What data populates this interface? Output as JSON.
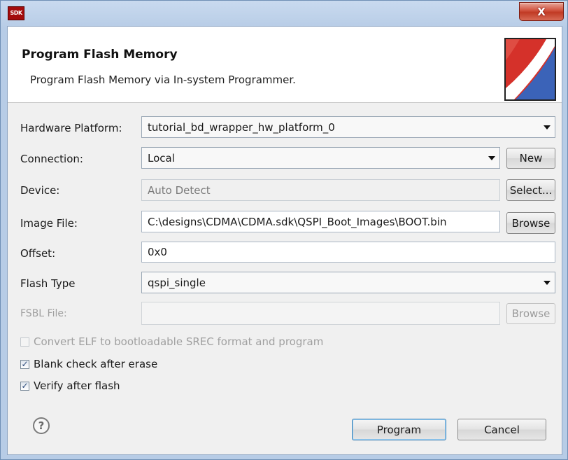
{
  "window": {
    "app_icon": "SDK",
    "close_glyph": "X"
  },
  "header": {
    "title": "Program Flash Memory",
    "description": "Program Flash Memory via In-system Programmer."
  },
  "form": {
    "hardware_platform": {
      "label": "Hardware Platform:",
      "value": "tutorial_bd_wrapper_hw_platform_0"
    },
    "connection": {
      "label": "Connection:",
      "value": "Local",
      "button": "New"
    },
    "device": {
      "label": "Device:",
      "value": "Auto Detect",
      "button": "Select..."
    },
    "image_file": {
      "label": "Image File:",
      "value": "C:\\designs\\CDMA\\CDMA.sdk\\QSPI_Boot_Images\\BOOT.bin",
      "button": "Browse"
    },
    "offset": {
      "label": "Offset:",
      "value": "0x0"
    },
    "flash_type": {
      "label": "Flash Type",
      "value": "qspi_single"
    },
    "fsbl_file": {
      "label": "FSBL File:",
      "value": "",
      "button": "Browse"
    }
  },
  "options": {
    "convert_elf": {
      "label": "Convert ELF to bootloadable SREC format and program",
      "checked": false,
      "enabled": false
    },
    "blank_check": {
      "label": "Blank check after erase",
      "checked": true,
      "enabled": true
    },
    "verify": {
      "label": "Verify after flash",
      "checked": true,
      "enabled": true
    }
  },
  "footer": {
    "help_glyph": "?",
    "program_button": "Program",
    "cancel_button": "Cancel"
  },
  "icons": [
    "sdk-app-icon",
    "close-icon",
    "flash-banner-icon",
    "dropdown-arrow-icon",
    "checkbox-icon",
    "help-icon"
  ],
  "colors": {
    "window_frame": "#b7cce6",
    "close_button": "#c03a24",
    "banner_red": "#d5312a",
    "banner_blue": "#3b63b8"
  }
}
